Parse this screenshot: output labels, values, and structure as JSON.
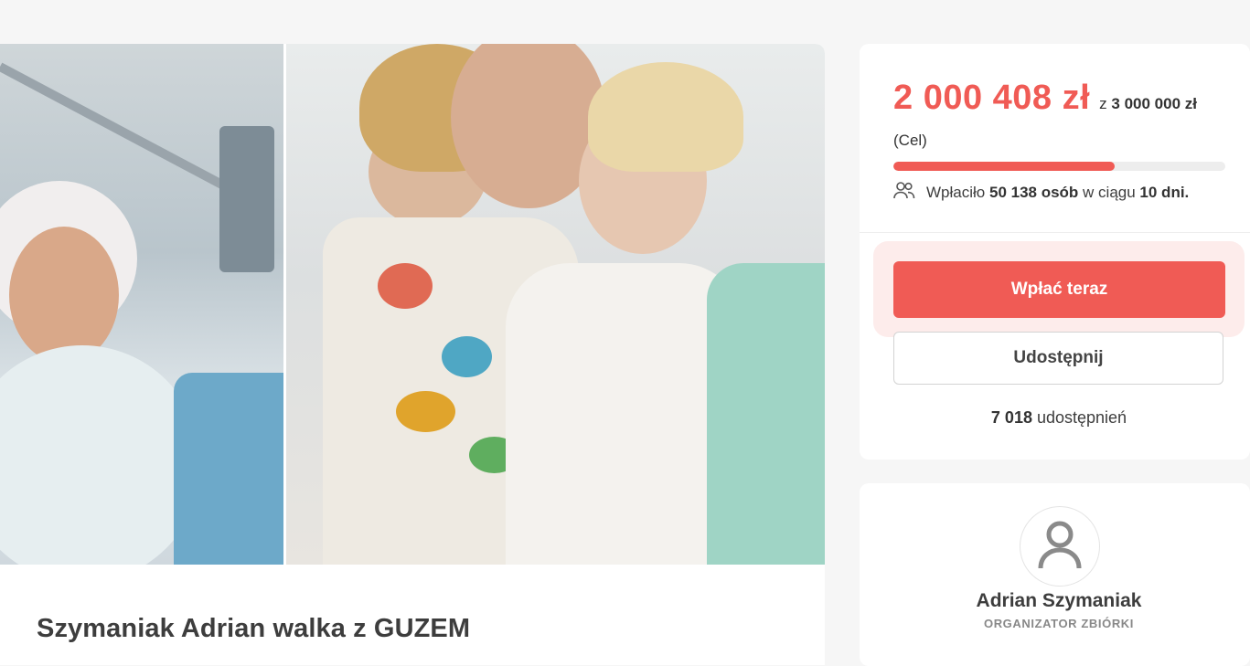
{
  "campaign": {
    "title": "Szymaniak Adrian walka z GUZEM",
    "photo_icon": "campaign-photo"
  },
  "donation": {
    "raised": "2 000 408 zł",
    "goal_prefix": "z",
    "goal": "3 000 000 zł",
    "goal_note": "(Cel)",
    "progress_fraction": 0.667,
    "donors_prefix": "Wpłaciło",
    "donors_count": "50 138 osób",
    "donors_mid": "w ciągu",
    "days": "10 dni.",
    "donate_label": "Wpłać teraz",
    "share_label": "Udostępnij",
    "shares_count": "7 018",
    "shares_suffix": "udostępnień",
    "accent_color": "#f05b55"
  },
  "organizer": {
    "name": "Adrian Szymaniak",
    "role": "ORGANIZATOR ZBIÓRKI",
    "avatar_icon": "user-icon"
  }
}
